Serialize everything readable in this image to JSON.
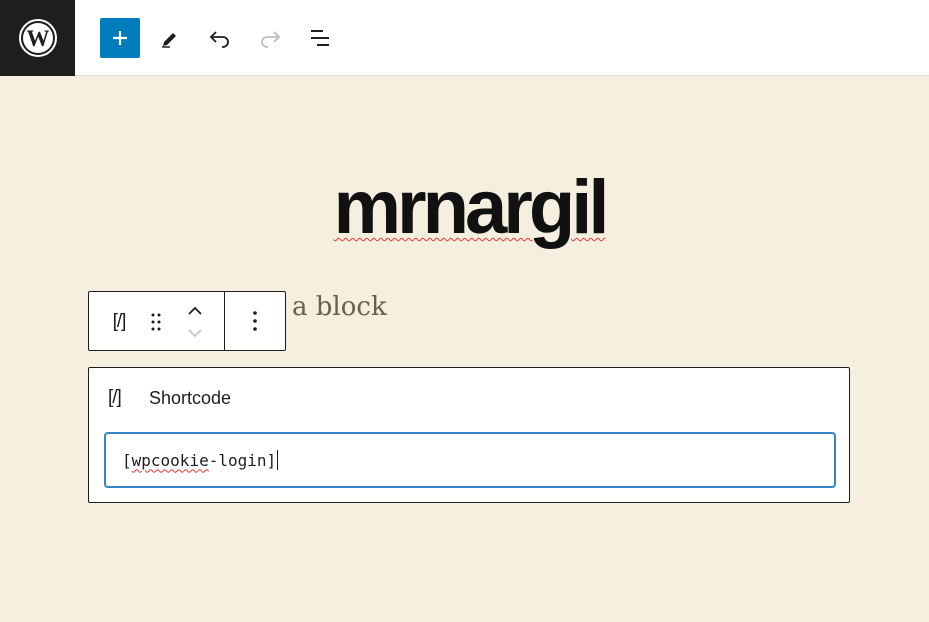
{
  "toolbar": {
    "logo_icon": "wordpress-logo-icon",
    "add_block_icon": "plus-icon",
    "tools_icon": "pencil-icon",
    "undo_icon": "undo-icon",
    "redo_icon": "redo-icon",
    "list_view_icon": "list-view-icon",
    "accent_color": "#007cba"
  },
  "site": {
    "title": "mrnargil"
  },
  "block_toolbar": {
    "block_type_icon": "[/]",
    "drag_icon": "drag-handle-icon",
    "move_up_icon": "chevron-up-icon",
    "move_down_icon": "chevron-down-icon",
    "options_icon": "more-vertical-icon"
  },
  "placeholder": {
    "text": "a block"
  },
  "shortcode_block": {
    "icon": "[/]",
    "label": "Shortcode",
    "value_prefix": "[",
    "value_spelled": "wpcookie",
    "value_suffix": "-login]"
  }
}
